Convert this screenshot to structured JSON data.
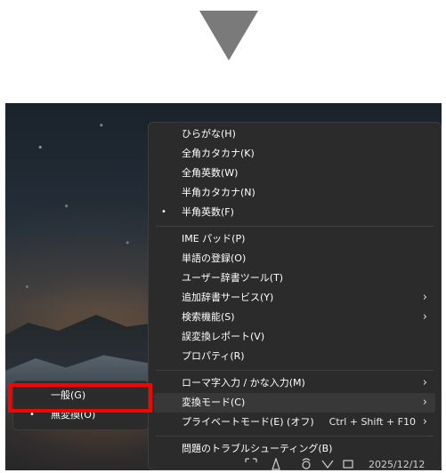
{
  "menu": {
    "items": [
      {
        "label": "ひらがな(H)"
      },
      {
        "label": "全角カタカナ(K)"
      },
      {
        "label": "全角英数(W)"
      },
      {
        "label": "半角カタカナ(N)"
      },
      {
        "label": "半角英数(F)",
        "checked": true
      },
      {
        "label": "IME パッド(P)"
      },
      {
        "label": "単語の登録(O)"
      },
      {
        "label": "ユーザー辞書ツール(T)"
      },
      {
        "label": "追加辞書サービス(Y)",
        "submenu": true
      },
      {
        "label": "検索機能(S)",
        "submenu": true
      },
      {
        "label": "誤変換レポート(V)"
      },
      {
        "label": "プロパティ(R)"
      },
      {
        "label": "ローマ字入力 / かな入力(M)",
        "submenu": true
      },
      {
        "label": "変換モード(C)",
        "submenu": true,
        "highlighted": true
      },
      {
        "label": "プライベートモード(E) (オフ)",
        "shortcut": "Ctrl + Shift + F10",
        "submenu": true
      },
      {
        "label": "問題のトラブルシューティング(B)"
      }
    ]
  },
  "submenu": {
    "items": [
      {
        "label": "一般(G)"
      },
      {
        "label": "無変換(O)",
        "checked": true
      }
    ]
  },
  "glyphs": {
    "bullet": "•",
    "chevron": "›"
  },
  "taskbar": {
    "clock": "2025/12/12"
  },
  "colors": {
    "menu_bg": "#2b2b2b",
    "highlight_bg": "#383838",
    "annotation": "#ff0000",
    "indicator_arrow": "#7a7a7a"
  }
}
